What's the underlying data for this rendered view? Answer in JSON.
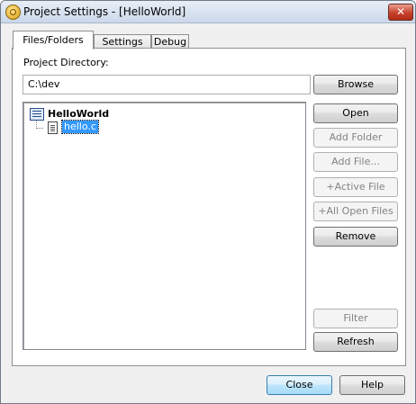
{
  "window": {
    "title": "Project Settings - [HelloWorld]",
    "close_glyph": "✕"
  },
  "tabs": [
    {
      "label": "Files/Folders",
      "active": true
    },
    {
      "label": "Settings",
      "active": false
    },
    {
      "label": "Debug",
      "active": false
    }
  ],
  "files": {
    "project_directory_label": "Project Directory:",
    "project_directory_value": "C:\\dev",
    "tree": {
      "root": "HelloWorld",
      "children": [
        "hello.c"
      ]
    },
    "buttons": {
      "browse": "Browse",
      "open": "Open",
      "add_folder": "Add Folder",
      "add_file": "Add File...",
      "add_active_file": "+Active File",
      "add_all_open_files": "+All Open Files",
      "remove": "Remove",
      "filter": "Filter",
      "refresh": "Refresh"
    }
  },
  "footer": {
    "close": "Close",
    "help": "Help"
  }
}
